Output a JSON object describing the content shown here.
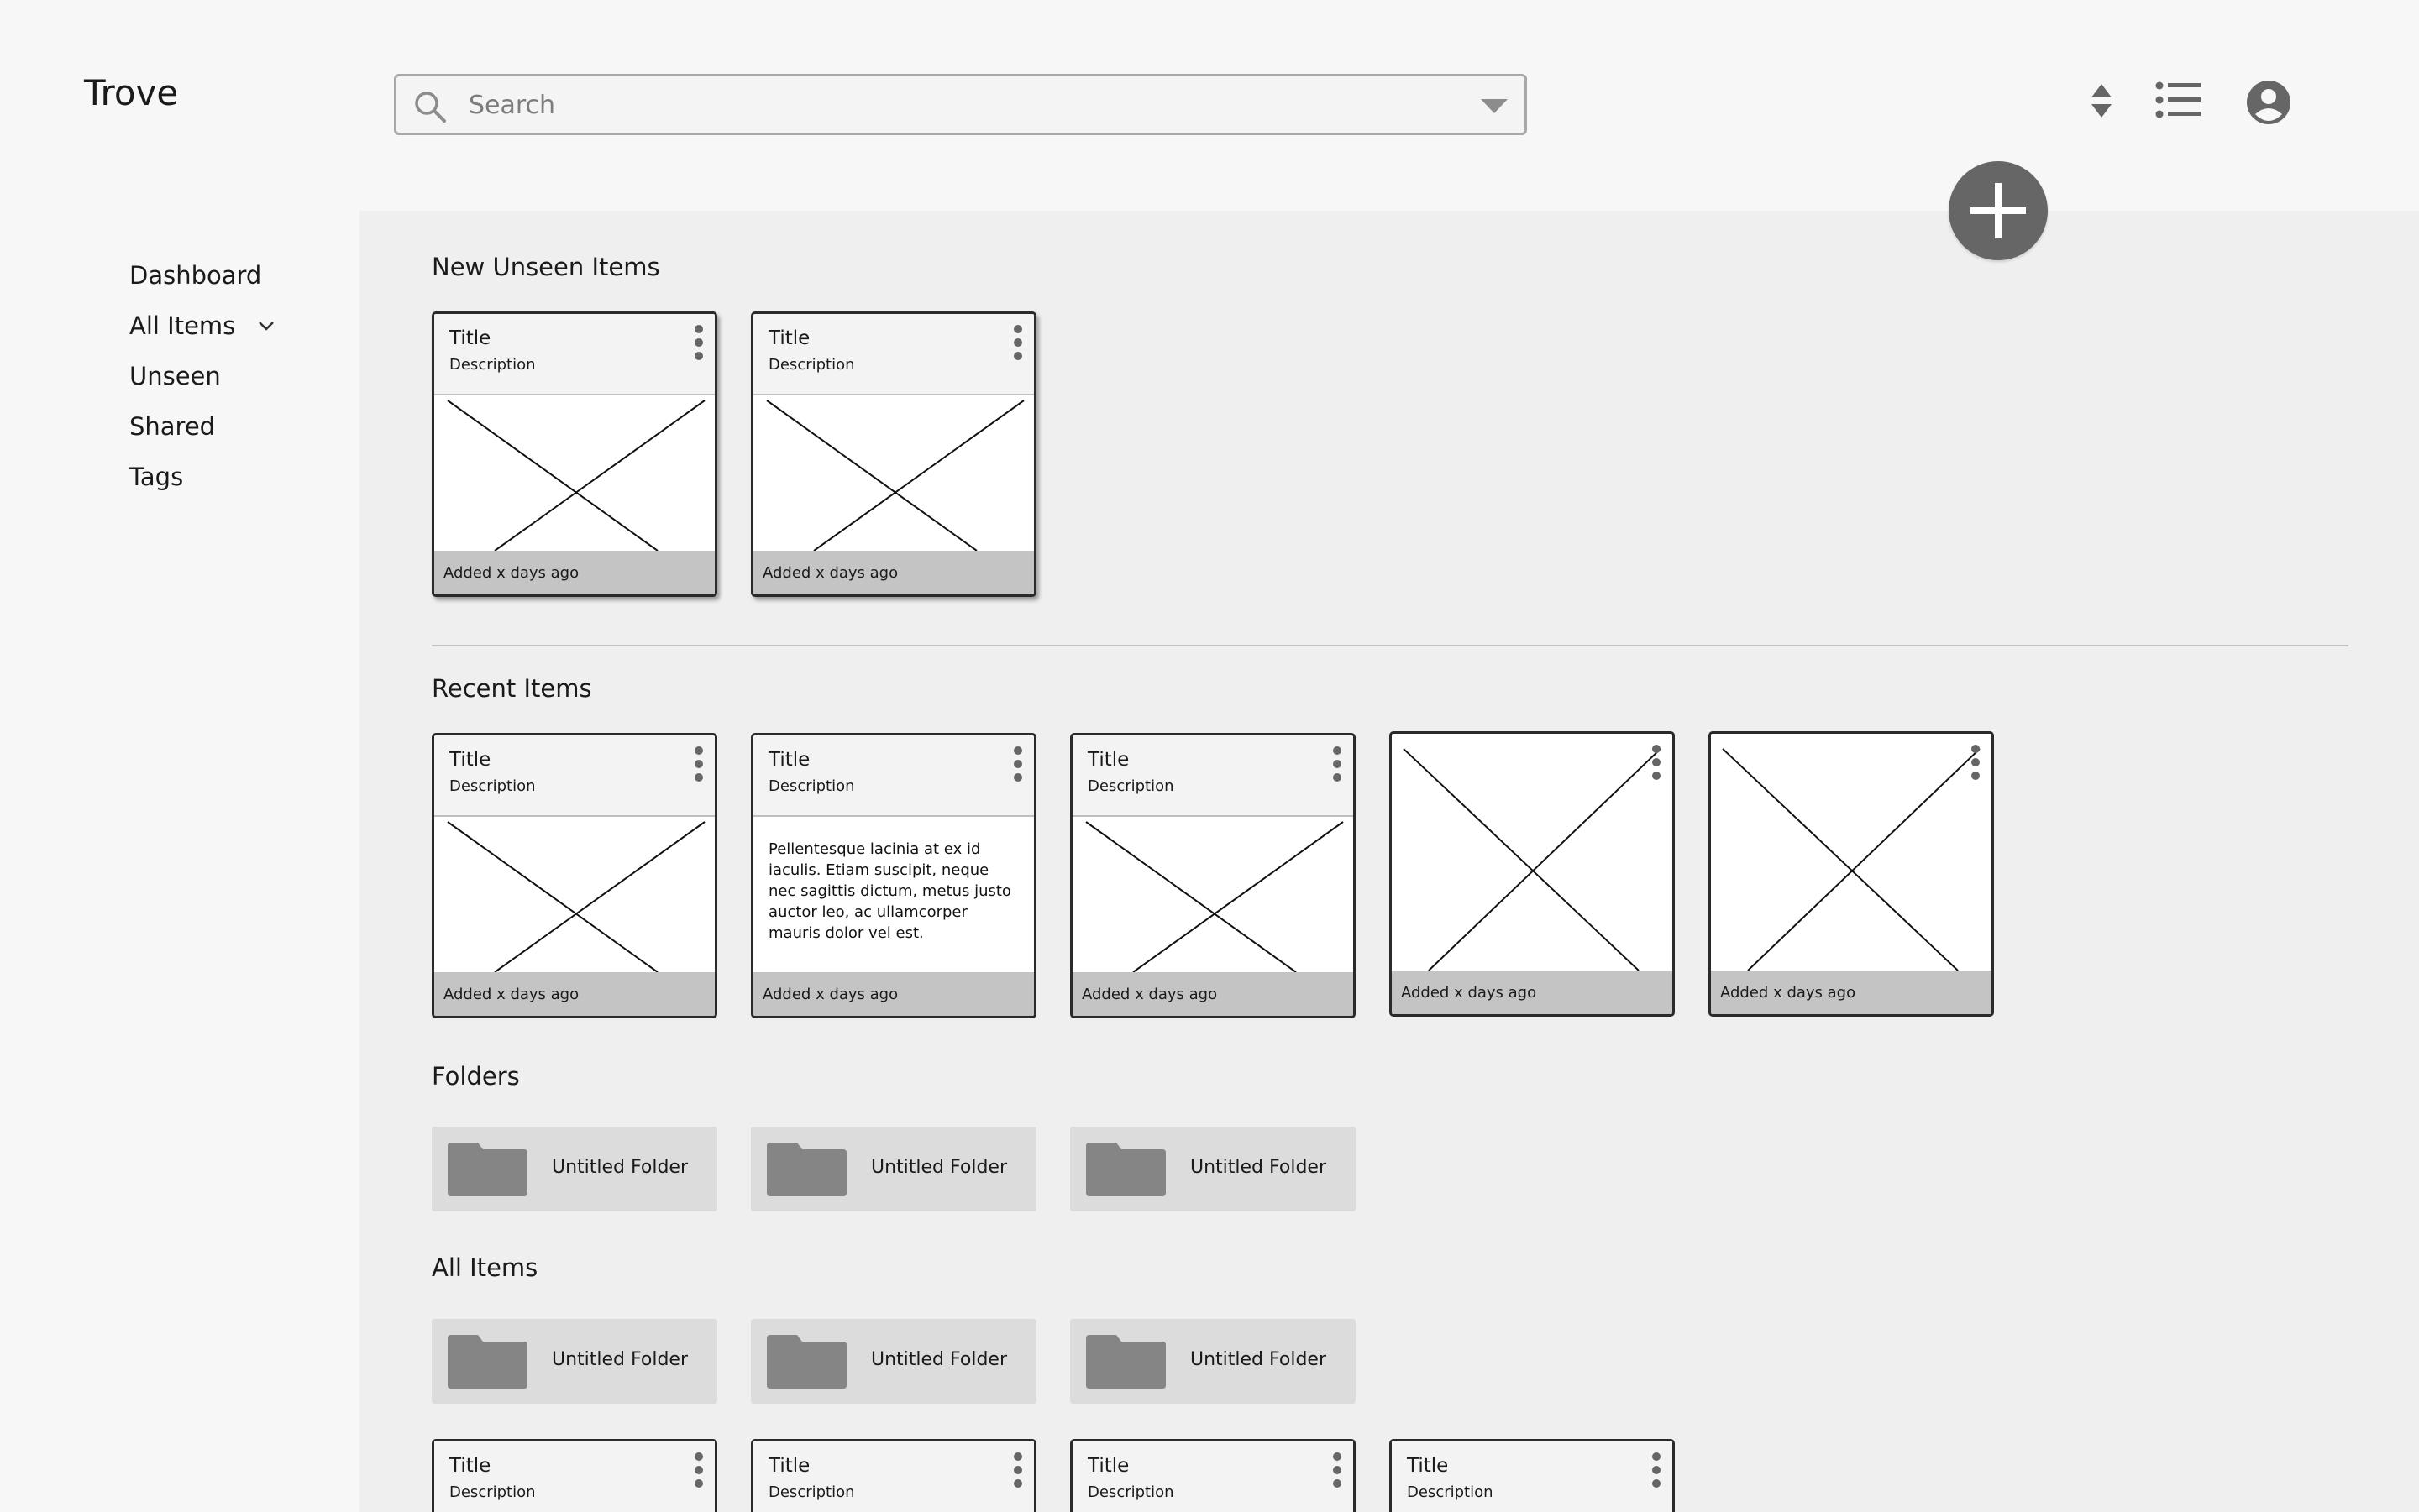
{
  "app": {
    "logo": "Trove"
  },
  "search": {
    "placeholder": "Search"
  },
  "sidebar": {
    "items": [
      {
        "label": "Dashboard"
      },
      {
        "label": "All Items"
      },
      {
        "label": "Unseen"
      },
      {
        "label": "Shared"
      },
      {
        "label": "Tags"
      }
    ]
  },
  "sections": {
    "new_unseen": {
      "title": "New Unseen Items",
      "cards": [
        {
          "title": "Title",
          "description": "Description",
          "footer": "Added x days ago"
        },
        {
          "title": "Title",
          "description": "Description",
          "footer": "Added x days ago"
        }
      ]
    },
    "recent": {
      "title": "Recent Items",
      "cards": [
        {
          "title": "Title",
          "description": "Description",
          "footer": "Added x days ago"
        },
        {
          "title": "Title",
          "description": "Description",
          "body_text": "Pellentesque lacinia at ex id iaculis. Etiam suscipit, neque nec sagittis dictum, metus justo auctor leo, ac ullamcorper mauris dolor vel est.",
          "footer": "Added x days ago"
        },
        {
          "title": "Title",
          "description": "Description",
          "footer": "Added x days ago"
        },
        {
          "footer": "Added x days ago"
        },
        {
          "footer": "Added x days ago"
        }
      ]
    },
    "folders": {
      "title": "Folders",
      "items": [
        {
          "label": "Untitled Folder"
        },
        {
          "label": "Untitled Folder"
        },
        {
          "label": "Untitled Folder"
        }
      ]
    },
    "all_items": {
      "title": "All Items",
      "folders": [
        {
          "label": "Untitled Folder"
        },
        {
          "label": "Untitled Folder"
        },
        {
          "label": "Untitled Folder"
        }
      ],
      "cards": [
        {
          "title": "Title",
          "description": "Description"
        },
        {
          "title": "Title",
          "description": "Description"
        },
        {
          "title": "Title",
          "description": "Description"
        },
        {
          "title": "Title",
          "description": "Description"
        }
      ]
    }
  },
  "colors": {
    "accent": "#666666",
    "panel": "#efefef",
    "footer": "#c4c4c4",
    "folder": "#dcdcdc"
  }
}
